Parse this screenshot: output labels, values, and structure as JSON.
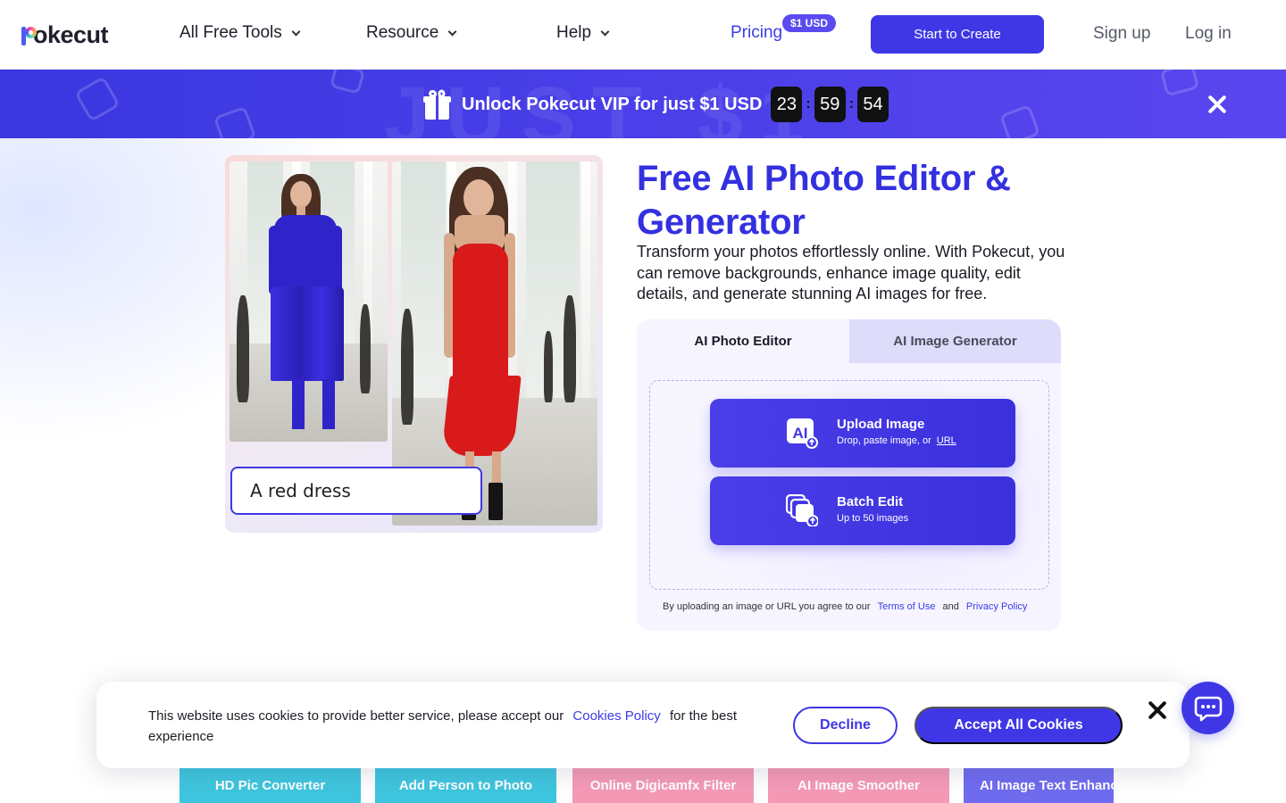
{
  "nav": {
    "brand": "Pokecut",
    "items": [
      {
        "label": "All Free Tools"
      },
      {
        "label": "Resource"
      },
      {
        "label": "Help"
      }
    ],
    "pricing_label": "Pricing",
    "pricing_badge": "$1 USD",
    "create_label": "Start to Create",
    "signup_label": "Sign up",
    "login_label": "Log in"
  },
  "banner": {
    "text": "Unlock Pokecut VIP for just $1 USD",
    "ghost_text": "JUST $1",
    "timer": {
      "hours": "23",
      "minutes": "59",
      "seconds": "54"
    },
    "close_icon": "close-icon"
  },
  "hero": {
    "title": "Free AI Photo Editor & Generator",
    "description": "Transform your photos effortlessly online. With Pokecut, you can remove backgrounds, enhance image quality, edit details, and generate stunning AI images for free.",
    "prompt_text": "A red dress"
  },
  "panel": {
    "tabs": [
      {
        "label": "AI Photo Editor",
        "active": true
      },
      {
        "label": "AI Image Generator",
        "active": false
      }
    ],
    "upload": {
      "title": "Upload Image",
      "subtitle": "Drop, paste image, or",
      "url_label": "URL",
      "icon_text": "AI"
    },
    "batch": {
      "title": "Batch Edit",
      "subtitle": "Up to 50 images"
    },
    "terms": {
      "prefix": "By uploading an image or URL you agree to our",
      "terms_label": "Terms of Use",
      "and": "and",
      "privacy_label": "Privacy Policy"
    }
  },
  "cookie": {
    "text_before": "This website uses cookies to provide better service, please accept our",
    "policy_label": "Cookies Policy",
    "text_after": "for the best experience",
    "decline_label": "Decline",
    "accept_label": "Accept All Cookies"
  },
  "tools": [
    {
      "label": "HD Pic Converter",
      "color": "#3ec6de"
    },
    {
      "label": "Add Person to Photo",
      "color": "#3ec6de"
    },
    {
      "label": "Online Digicamfx Filter",
      "color": "#f59ab6"
    },
    {
      "label": "AI Image Smoother",
      "color": "#f59ab6"
    },
    {
      "label": "AI Image Text Enhancer",
      "color": "#6f6cf0"
    }
  ],
  "colors": {
    "brand": "#3f37e6",
    "title": "#3330e0",
    "banner": "#4a3fe8"
  }
}
